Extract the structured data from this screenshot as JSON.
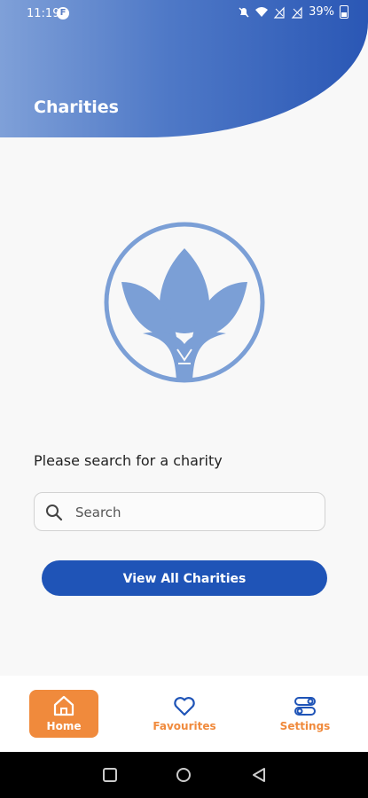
{
  "status_bar": {
    "time": "11:19",
    "app_badge": "F",
    "battery_pct": "39%"
  },
  "header": {
    "title": "Charities"
  },
  "main": {
    "prompt": "Please search for a charity",
    "search": {
      "placeholder": "Search",
      "value": ""
    },
    "view_all_label": "View All Charities"
  },
  "bottom_nav": {
    "items": [
      {
        "label": "Home",
        "icon": "home-icon",
        "active": true
      },
      {
        "label": "Favourites",
        "icon": "heart-icon",
        "active": false
      },
      {
        "label": "Settings",
        "icon": "toggles-icon",
        "active": false
      }
    ]
  },
  "colors": {
    "accent": "#f08a3c",
    "primary": "#1f54b7",
    "logo": "#7b9fd6"
  }
}
